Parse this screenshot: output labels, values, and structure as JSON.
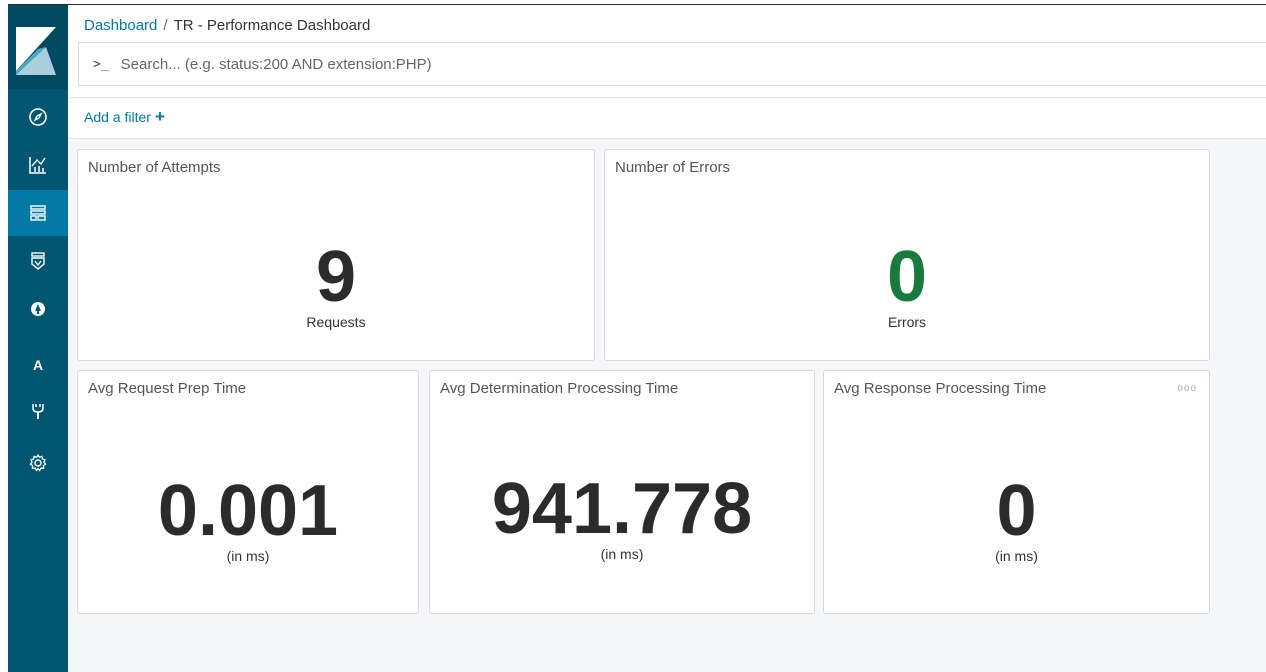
{
  "sidebar": {
    "items": [
      {
        "name": "discover",
        "icon": "compass-icon"
      },
      {
        "name": "visualize",
        "icon": "bar-chart-icon"
      },
      {
        "name": "dashboard",
        "icon": "dashboard-icon",
        "active": true
      },
      {
        "name": "timelion",
        "icon": "shield-icon"
      },
      {
        "name": "apm",
        "icon": "apm-icon"
      },
      {
        "name": "app",
        "icon": "letter-a-icon",
        "text": "A"
      },
      {
        "name": "dev-tools",
        "icon": "wrench-icon"
      },
      {
        "name": "management",
        "icon": "gear-icon"
      }
    ]
  },
  "header": {
    "breadcrumb_root": "Dashboard",
    "breadcrumb_separator": "/",
    "breadcrumb_current": "TR - Performance Dashboard",
    "search_prompt": ">_",
    "search_placeholder": "Search... (e.g. status:200 AND extension:PHP)"
  },
  "filterbar": {
    "add_filter_label": "Add a filter",
    "add_filter_plus": "+"
  },
  "panels": {
    "attempts": {
      "title": "Number of Attempts",
      "value": "9",
      "label": "Requests"
    },
    "errors": {
      "title": "Number of Errors",
      "value": "0",
      "label": "Errors",
      "value_color": "#1a7a3e"
    },
    "prep": {
      "title": "Avg Request Prep Time",
      "value": "0.001",
      "label": "(in ms)"
    },
    "determination": {
      "title": "Avg Determination Processing Time",
      "value": "941.778",
      "label": "(in ms)"
    },
    "response": {
      "title": "Avg Response Processing Time",
      "value": "0",
      "label": "(in ms)",
      "options": "ooo"
    }
  },
  "colors": {
    "sidebar": "#005571",
    "sidebar_active": "#0079a5",
    "link": "#0079a5",
    "success": "#1a7a3e"
  }
}
